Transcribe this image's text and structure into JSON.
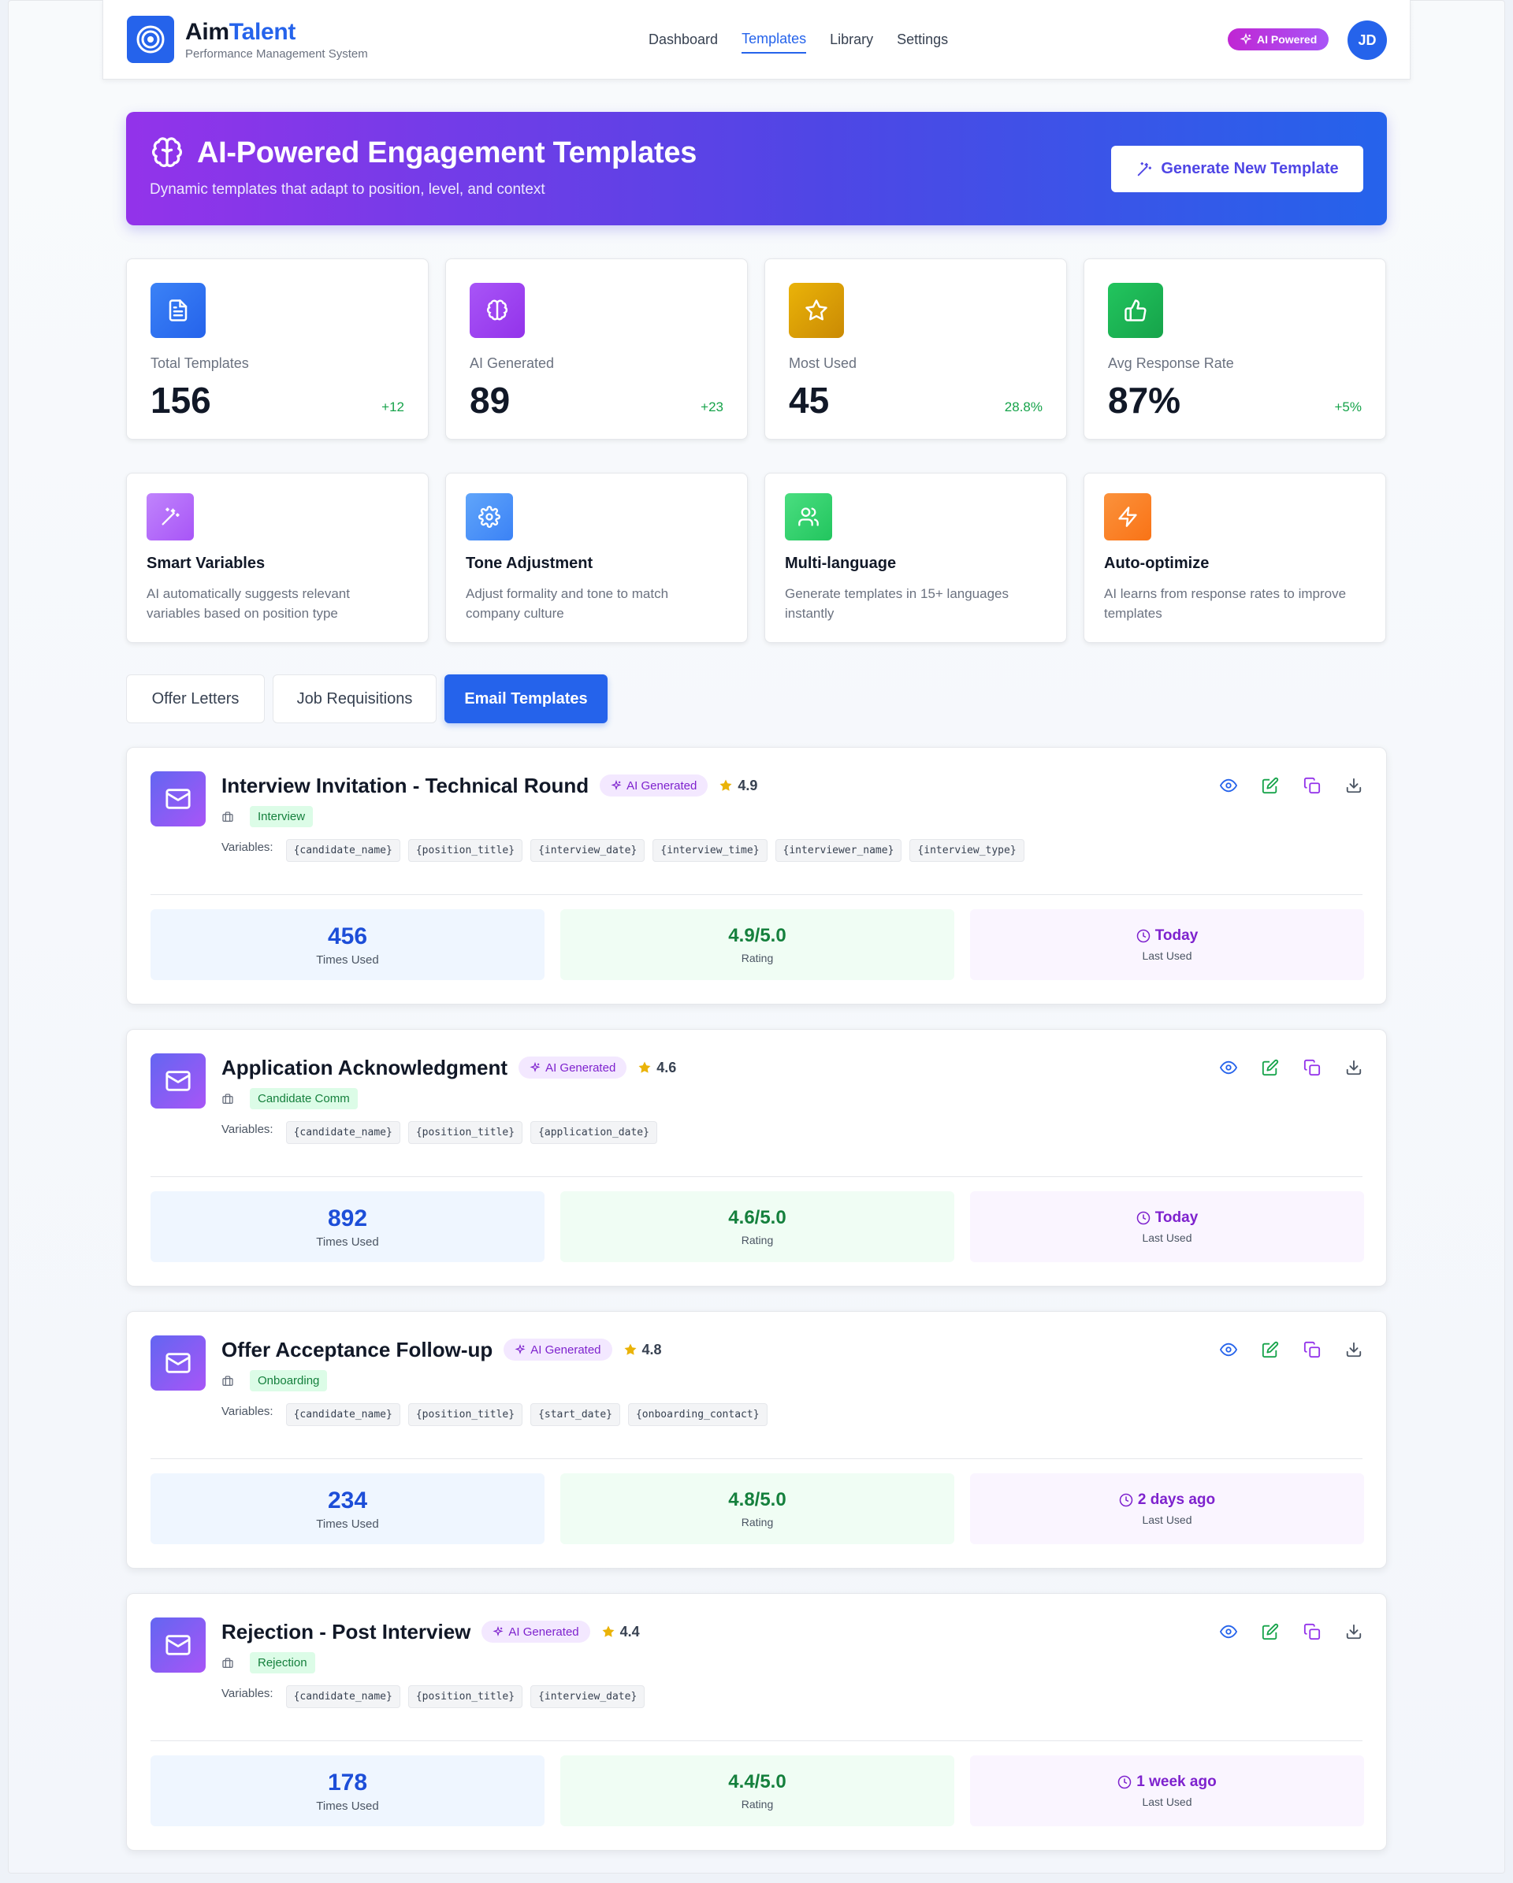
{
  "app": {
    "brand_part1": "Aim",
    "brand_part2": "Talent",
    "subtitle": "Performance Management System",
    "ai_badge": "AI Powered",
    "avatar_initials": "JD"
  },
  "nav": {
    "items": [
      {
        "label": "Dashboard",
        "active": false
      },
      {
        "label": "Templates",
        "active": true
      },
      {
        "label": "Library",
        "active": false
      },
      {
        "label": "Settings",
        "active": false
      }
    ]
  },
  "hero": {
    "title": "AI-Powered Engagement Templates",
    "subtitle": "Dynamic templates that adapt to position, level, and context",
    "button_label": "Generate New Template"
  },
  "stats": [
    {
      "label": "Total Templates",
      "value": "156",
      "delta": "+12",
      "icon": "document-icon",
      "color": "#2563eb"
    },
    {
      "label": "AI Generated",
      "value": "89",
      "delta": "+23",
      "icon": "brain-icon",
      "color": "#9333ea"
    },
    {
      "label": "Most Used",
      "value": "45",
      "delta": "28.8%",
      "icon": "star-icon",
      "color": "#ca8a04"
    },
    {
      "label": "Avg Response Rate",
      "value": "87%",
      "delta": "+5%",
      "icon": "thumbs-up-icon",
      "color": "#16a34a"
    }
  ],
  "features": [
    {
      "title": "Smart Variables",
      "desc": "AI automatically suggests relevant variables based on position type",
      "icon": "magic-wand-icon",
      "color": "#a855f7"
    },
    {
      "title": "Tone Adjustment",
      "desc": "Adjust formality and tone to match company culture",
      "icon": "gear-icon",
      "color": "#3b82f6"
    },
    {
      "title": "Multi-language",
      "desc": "Generate templates in 15+ languages instantly",
      "icon": "users-icon",
      "color": "#22c55e"
    },
    {
      "title": "Auto-optimize",
      "desc": "AI learns from response rates to improve templates",
      "icon": "lightning-icon",
      "color": "#f97316"
    }
  ],
  "tabs": [
    {
      "label": "Offer Letters",
      "active": false
    },
    {
      "label": "Job Requisitions",
      "active": false
    },
    {
      "label": "Email Templates",
      "active": true
    }
  ],
  "templates": [
    {
      "title": "Interview Invitation - Technical Round",
      "ai_label": "AI Generated",
      "rating": "4.9",
      "category": "Interview",
      "variables_label": "Variables:",
      "variables": [
        "{candidate_name}",
        "{position_title}",
        "{interview_date}",
        "{interview_time}",
        "{interviewer_name}",
        "{interview_type}"
      ],
      "times_used": "456",
      "times_used_label": "Times Used",
      "rating_full": "4.9/5.0",
      "rating_label": "Rating",
      "last_used": "Today",
      "last_used_label": "Last Used"
    },
    {
      "title": "Application Acknowledgment",
      "ai_label": "AI Generated",
      "rating": "4.6",
      "category": "Candidate Comm",
      "variables_label": "Variables:",
      "variables": [
        "{candidate_name}",
        "{position_title}",
        "{application_date}"
      ],
      "times_used": "892",
      "times_used_label": "Times Used",
      "rating_full": "4.6/5.0",
      "rating_label": "Rating",
      "last_used": "Today",
      "last_used_label": "Last Used"
    },
    {
      "title": "Offer Acceptance Follow-up",
      "ai_label": "AI Generated",
      "rating": "4.8",
      "category": "Onboarding",
      "variables_label": "Variables:",
      "variables": [
        "{candidate_name}",
        "{position_title}",
        "{start_date}",
        "{onboarding_contact}"
      ],
      "times_used": "234",
      "times_used_label": "Times Used",
      "rating_full": "4.8/5.0",
      "rating_label": "Rating",
      "last_used": "2 days ago",
      "last_used_label": "Last Used"
    },
    {
      "title": "Rejection - Post Interview",
      "ai_label": "AI Generated",
      "rating": "4.4",
      "category": "Rejection",
      "variables_label": "Variables:",
      "variables": [
        "{candidate_name}",
        "{position_title}",
        "{interview_date}"
      ],
      "times_used": "178",
      "times_used_label": "Times Used",
      "rating_full": "4.4/5.0",
      "rating_label": "Rating",
      "last_used": "1 week ago",
      "last_used_label": "Last Used"
    }
  ],
  "colors": {
    "primary": "#2563eb",
    "purple": "#9333ea",
    "success": "#16a34a"
  }
}
